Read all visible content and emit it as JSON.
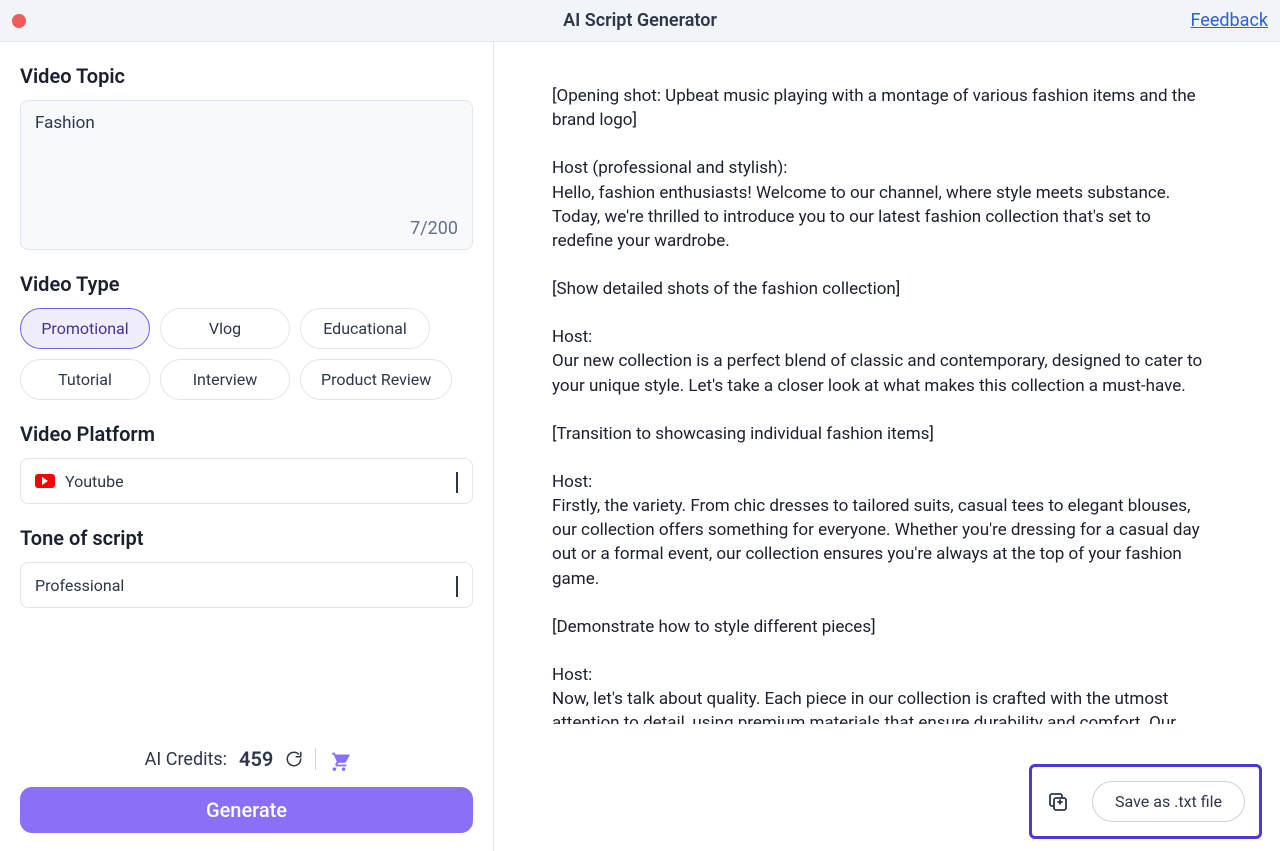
{
  "header": {
    "title": "AI Script Generator",
    "feedback_label": "Feedback"
  },
  "left": {
    "topic_label": "Video Topic",
    "topic_value": "Fashion",
    "char_counter": "7/200",
    "video_type_label": "Video Type",
    "video_types": [
      {
        "label": "Promotional",
        "selected": true
      },
      {
        "label": "Vlog",
        "selected": false
      },
      {
        "label": "Educational",
        "selected": false
      },
      {
        "label": "Tutorial",
        "selected": false
      },
      {
        "label": "Interview",
        "selected": false
      },
      {
        "label": "Product Review",
        "selected": false
      }
    ],
    "platform_label": "Video Platform",
    "platform_value": "Youtube",
    "tone_label": "Tone of script",
    "tone_value": "Professional",
    "credits_label": "AI Credits:",
    "credits_value": "459",
    "generate_label": "Generate"
  },
  "right": {
    "script_text": "[Opening shot: Upbeat music playing with a montage of various fashion items and the brand logo]\n\nHost (professional and stylish):\nHello, fashion enthusiasts! Welcome to our channel, where style meets substance. Today, we're thrilled to introduce you to our latest fashion collection that's set to redefine your wardrobe.\n\n[Show detailed shots of the fashion collection]\n\nHost:\nOur new collection is a perfect blend of classic and contemporary, designed to cater to your unique style. Let's take a closer look at what makes this collection a must-have.\n\n[Transition to showcasing individual fashion items]\n\nHost:\nFirstly, the variety. From chic dresses to tailored suits, casual tees to elegant blouses, our collection offers something for everyone. Whether you're dressing for a casual day out or a formal event, our collection ensures you're always at the top of your fashion game.\n\n[Demonstrate how to style different pieces]\n\nHost:\nNow, let's talk about quality. Each piece in our collection is crafted with the utmost attention to detail, using premium materials that ensure durability and comfort. Our designs are not just about looking good, but also about feeling good.\n\n[Cut to before-and-after shots of models wearing the fashion items]",
    "save_label": "Save as .txt file"
  }
}
